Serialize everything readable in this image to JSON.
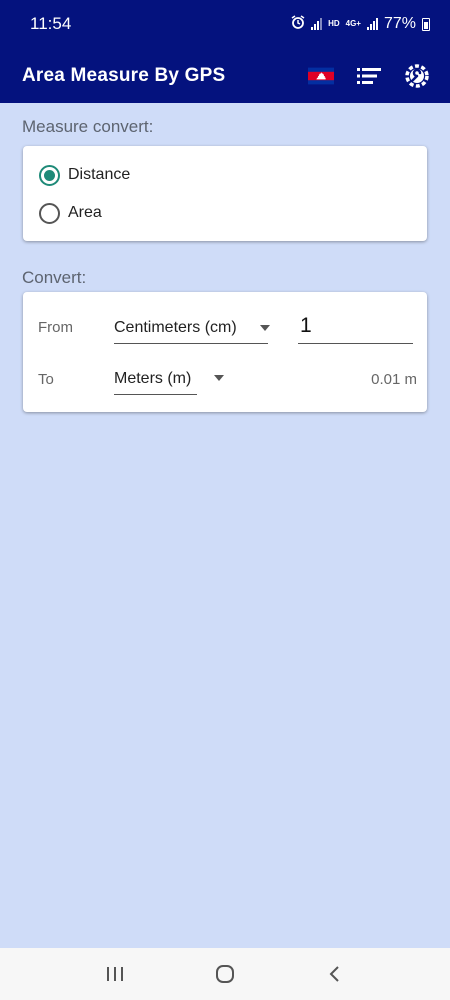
{
  "status_bar": {
    "time": "11:54",
    "network_hd": "HD",
    "network_4g": "4G+",
    "battery": "77%"
  },
  "app_bar": {
    "title": "Area Measure By GPS",
    "icons": [
      "cambodia-flag-icon",
      "list-icon",
      "settings-wrench-icon"
    ]
  },
  "measure_convert": {
    "label": "Measure convert:",
    "options": [
      {
        "label": "Distance",
        "checked": true
      },
      {
        "label": "Area",
        "checked": false
      }
    ]
  },
  "convert": {
    "label": "Convert:",
    "from_label": "From",
    "from_unit": "Centimeters (cm)",
    "from_value": "1",
    "to_label": "To",
    "to_unit": "Meters (m)",
    "result": "0.01 m"
  },
  "nav_bar": {
    "icons": [
      "recents-icon",
      "home-icon",
      "back-icon"
    ]
  },
  "colors": {
    "app_bar": "#04127e",
    "background": "#cfdcf8",
    "accent": "#1e8a78"
  }
}
